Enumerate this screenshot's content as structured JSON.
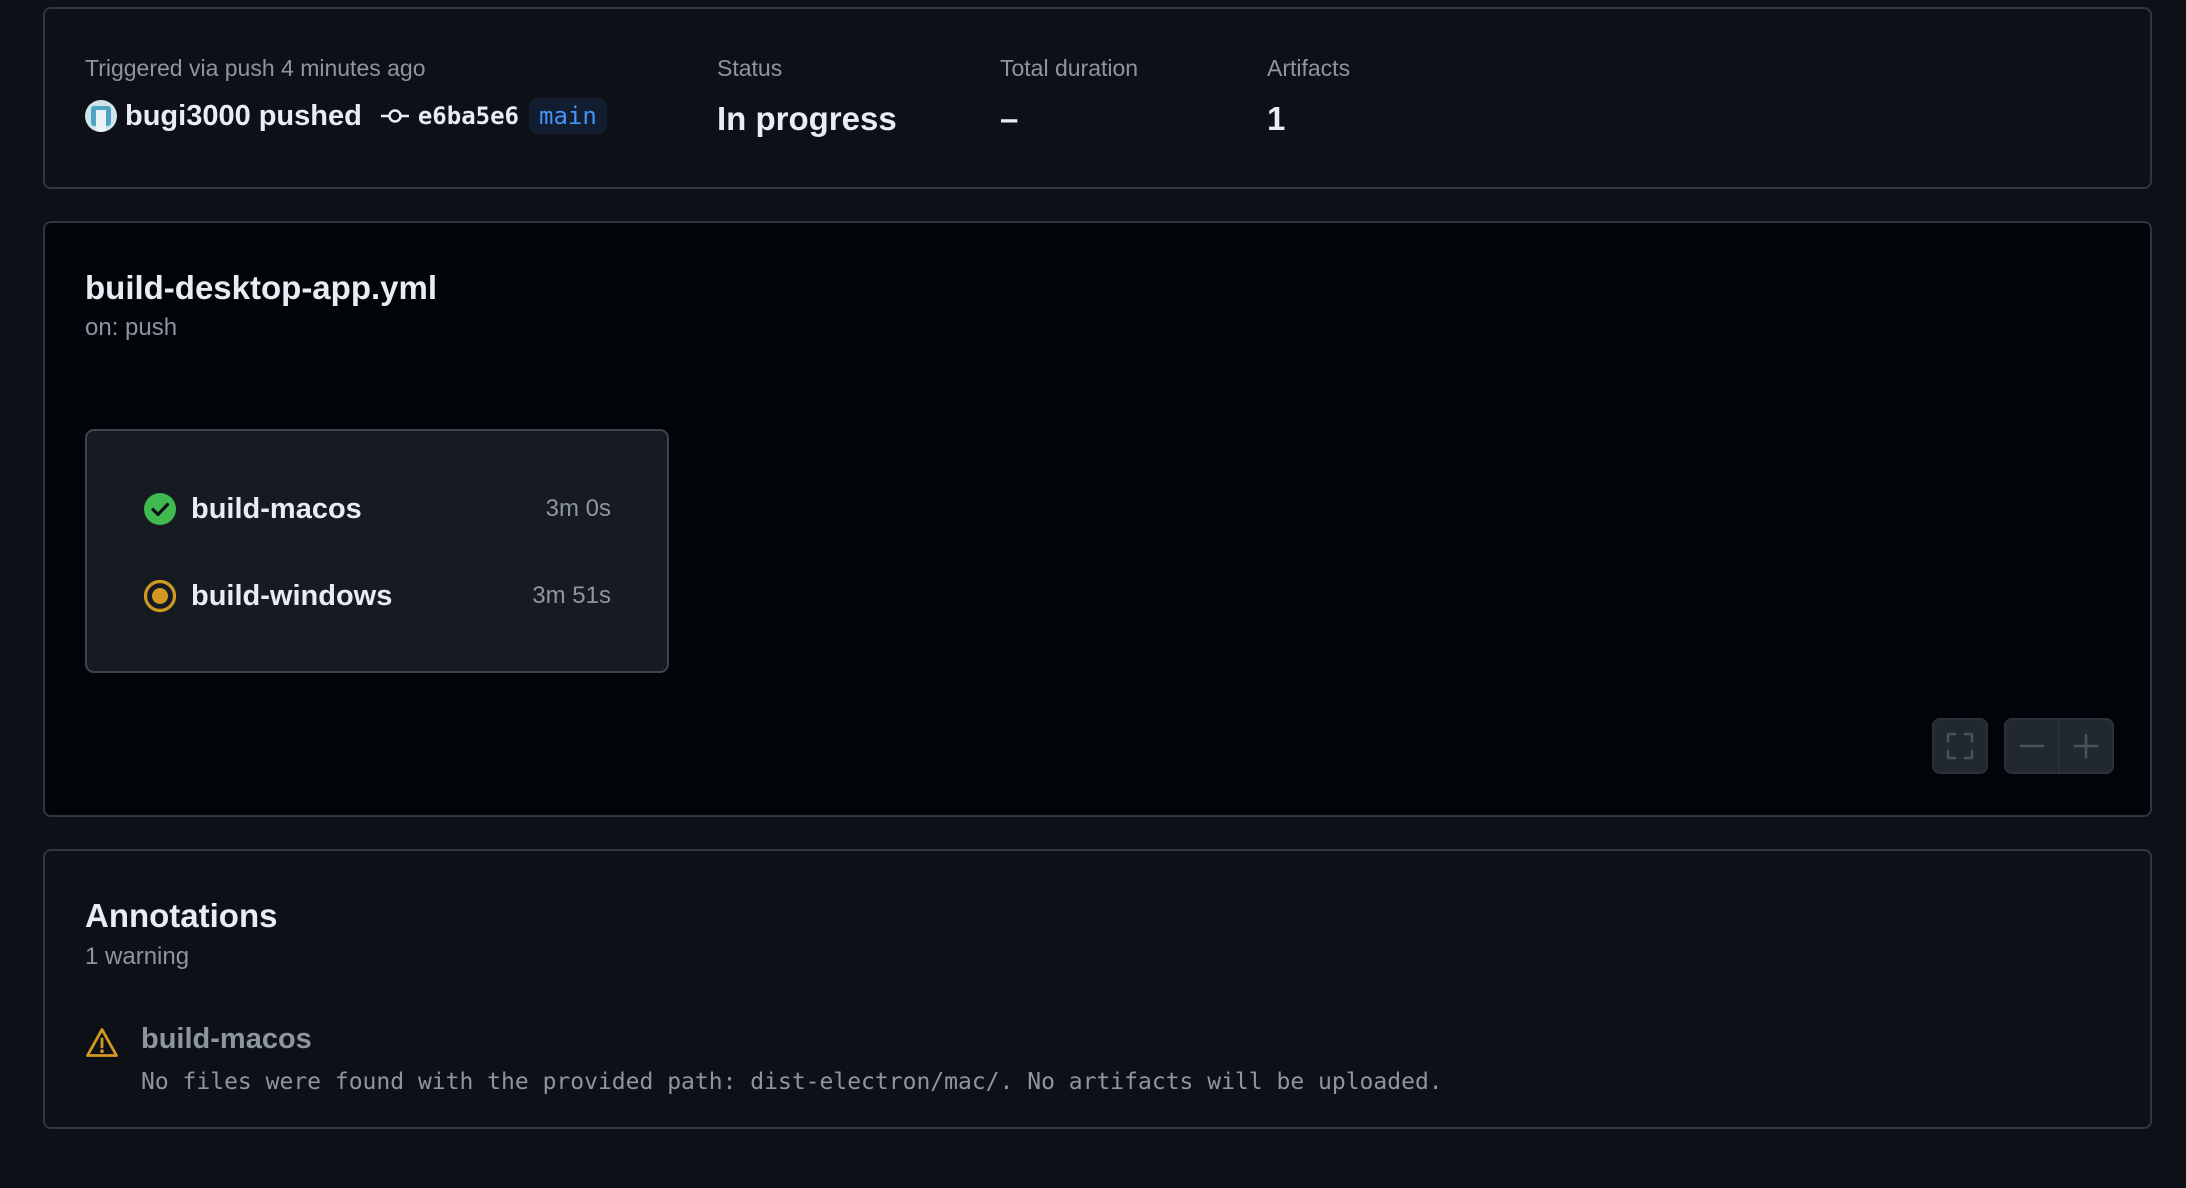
{
  "summary": {
    "trigger_label": "Triggered via push 4 minutes ago",
    "actor": "bugi3000",
    "action": "pushed",
    "commit_sha": "e6ba5e6",
    "branch": "main",
    "status_label": "Status",
    "status_value": "In progress",
    "duration_label": "Total duration",
    "duration_value": "–",
    "artifacts_label": "Artifacts",
    "artifacts_value": "1"
  },
  "workflow": {
    "file_name": "build-desktop-app.yml",
    "trigger": "on: push",
    "jobs": [
      {
        "name": "build-macos",
        "duration": "3m 0s",
        "status": "success",
        "icon": "check-circle-icon"
      },
      {
        "name": "build-windows",
        "duration": "3m 51s",
        "status": "in_progress",
        "icon": "in-progress-icon"
      }
    ],
    "controls": [
      "fullscreen-icon",
      "zoom-out-icon",
      "zoom-in-icon"
    ]
  },
  "annotations": {
    "title": "Annotations",
    "summary": "1 warning",
    "items": [
      {
        "type": "warning",
        "icon": "warning-icon",
        "job": "build-macos",
        "message": "No files were found with the provided path: dist-electron/mac/. No artifacts will be uploaded."
      }
    ]
  },
  "colors": {
    "success": "#3fb950",
    "in_progress": "#d29922",
    "link": "#4493f8",
    "muted": "#8d96a0"
  }
}
